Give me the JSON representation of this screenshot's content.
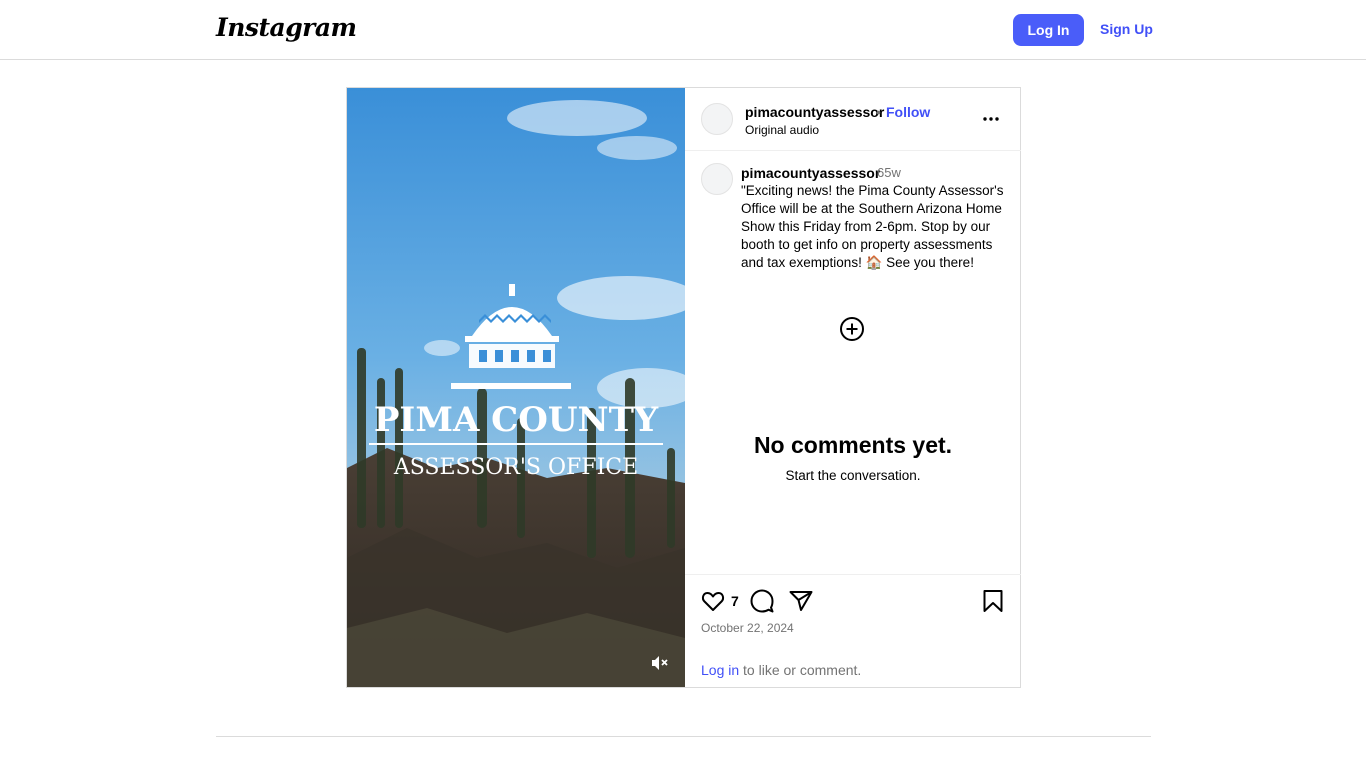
{
  "header": {
    "logo_text": "Instagram",
    "login_label": "Log In",
    "signup_label": "Sign Up"
  },
  "post": {
    "username": "pimacountyassessor",
    "separator": "•",
    "follow_label": "Follow",
    "audio_label": "Original audio",
    "media_overlay": {
      "title": "PIMA COUNTY",
      "subtitle": "ASSESSOR'S OFFICE"
    },
    "caption": {
      "username": "pimacountyassessor",
      "time_ago": "65w",
      "text": "\"Exciting news! the Pima County Assessor's Office will be at the Southern Arizona Home Show this Friday from 2-6pm. Stop by our booth to get info on property assessments and tax exemptions! 🏠 See you there!"
    },
    "empty_comments": {
      "title": "No comments yet.",
      "subtitle": "Start the conversation."
    },
    "likes": "7",
    "date": "October 22, 2024",
    "login_prompt": {
      "link_text": "Log in",
      "rest_text": " to like or comment."
    }
  },
  "icons": {
    "media_mute": "speaker-muted-icon",
    "more": "more-horizontal-icon",
    "add_comment": "plus-circle-icon",
    "like": "heart-icon",
    "comment": "comment-icon",
    "share": "paper-plane-icon",
    "save": "bookmark-icon"
  },
  "colors": {
    "accent": "#4a5df9",
    "link": "#4150f7",
    "muted_text": "#737373",
    "border": "#dbdbdb"
  }
}
